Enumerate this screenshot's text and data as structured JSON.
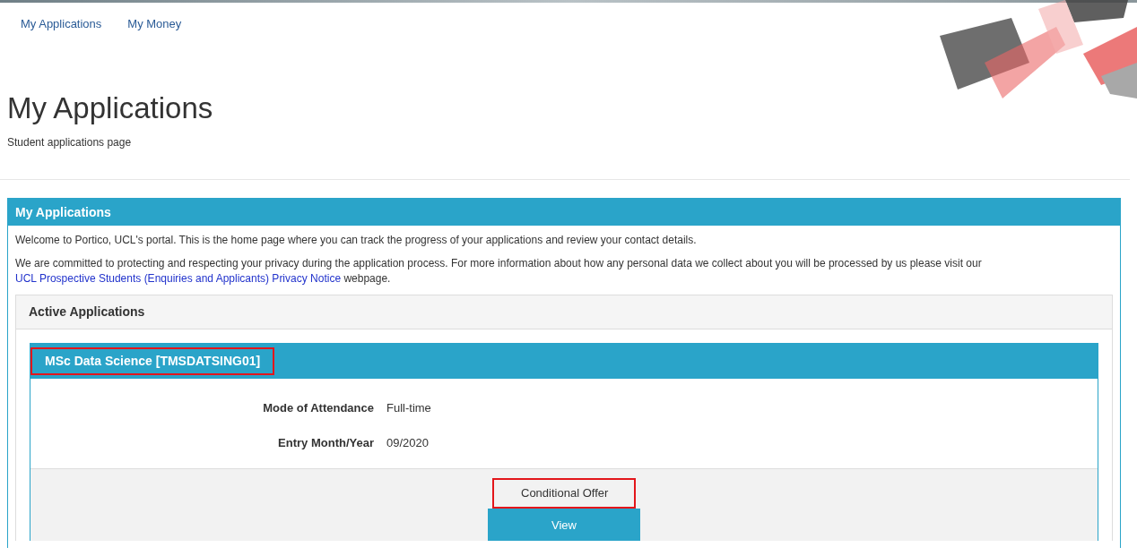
{
  "nav": [
    {
      "label": "My Applications"
    },
    {
      "label": "My Money"
    }
  ],
  "page": {
    "title": "My Applications",
    "subtitle": "Student applications page"
  },
  "panel": {
    "title": "My Applications",
    "intro": "Welcome to Portico, UCL's portal. This is the home page where you can track the progress of your applications and review your contact details.",
    "privacy_before": "We are committed to protecting and respecting your privacy during the application process. For more information about how any personal data we collect about you will be processed by us please visit our",
    "privacy_link": "UCL Prospective Students (Enquiries and Applicants) Privacy Notice",
    "privacy_after": "webpage.",
    "active": {
      "title": "Active Applications",
      "applications": [
        {
          "title": "MSc Data Science [TMSDATSING01]",
          "title_highlighted": true,
          "fields": [
            {
              "label": "Mode of Attendance",
              "value": "Full-time"
            },
            {
              "label": "Entry Month/Year",
              "value": "09/2020"
            }
          ],
          "status": "Conditional Offer",
          "status_highlighted": true,
          "button": "View"
        }
      ]
    }
  }
}
